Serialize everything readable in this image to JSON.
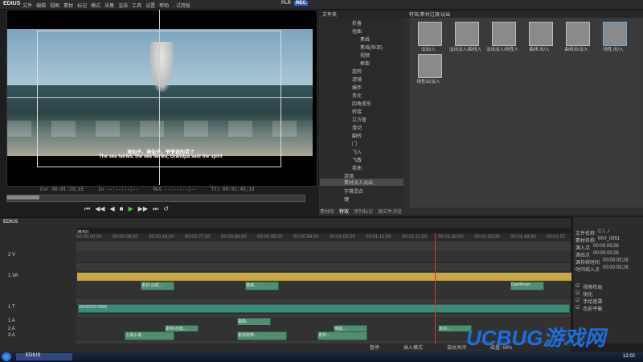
{
  "app": {
    "title": "EDIUS",
    "menus": [
      "文件",
      "编辑",
      "视图",
      "素材",
      "标记",
      "模式",
      "采集",
      "渲染",
      "工具",
      "设置",
      "帮助",
      "- 试用版"
    ],
    "plr": "PLR",
    "rec": "REC"
  },
  "preview": {
    "subtitle_cn": "海仙子，海仙子，爷爷说的灵了",
    "subtitle_en": "The sea fairies, the sea fairies, Grandpa said the spirit",
    "timecodes": [
      "Cur 00:01:29;15",
      "In --:--:--;--",
      "Out --:--:--;--",
      "Ttl 00:01:49;13"
    ]
  },
  "transport": [
    "⏮",
    "◀◀",
    "◀",
    "■",
    "▶",
    "▶▶",
    "⏭",
    "↺"
  ],
  "effects": {
    "header": "文件夹",
    "path": "特效/素材过渡/淡出",
    "tree": [
      "折叠",
      "扭曲",
      "素线",
      "素线(纵深)",
      "视频",
      "框架",
      "旋转",
      "滤镜",
      "爆炸",
      "变化",
      "四角变形",
      "转接",
      "立方管",
      "滑动",
      "翻转",
      "门",
      "飞入",
      "飞散",
      "卷曲",
      "涟漪",
      "素材淡入淡出",
      "字幕混合",
      "键"
    ],
    "selected": "素材淡入淡出",
    "items": [
      "淡出/入",
      "淡出淡入/曲线入",
      "淡出淡入/线性入",
      "曲线 出/入",
      "曲线出/淡入",
      "线性 出/入",
      "线性出/淡入"
    ],
    "tabs": [
      "素材库",
      "特效",
      "序列标记",
      "源文件浏览"
    ]
  },
  "timeline": {
    "title": "EDIUS",
    "seq": "序列1",
    "ruler": [
      "00:00:00;00",
      "00:00:09;00",
      "00:00:18;00",
      "00:00:27;00",
      "00:00:36;00",
      "00:00:45;00",
      "00:00:54;00",
      "00:01:03;00",
      "00:01:12;00",
      "00:01:21;00",
      "00:01:30;00",
      "00:01:39;00",
      "00:01:48;00",
      "00:01:57"
    ],
    "tracks": [
      "2 V",
      "1 VA",
      "1 T",
      "1 A",
      "2 A",
      "3 A",
      "4 A"
    ],
    "title_clip": "20150703-0000",
    "audio_clips": [
      "小溪小溪",
      "素材-合成...",
      "素材效果...",
      "歌曲...",
      "水中...",
      "歌曲...",
      "电视...",
      "素材...",
      "DSC...",
      "素材...",
      "DarkRoom",
      "海..."
    ]
  },
  "info": {
    "rows": [
      [
        "文件名称",
        "C:/.../"
      ],
      [
        "素材名称",
        "MVI_0851"
      ],
      [
        "源入点",
        "00:00:03;26"
      ],
      [
        "源出点",
        "00:00:03;28"
      ],
      [
        "源持续时间",
        "00:00:03;28"
      ],
      [
        "时间线入点",
        "00:00:03;26"
      ]
    ],
    "effects": [
      "视频布局",
      "锐化",
      "手绘遮罩",
      "色彩平衡"
    ]
  },
  "status": [
    "暂停",
    "插入模式",
    "波纹关闭",
    "磁盘: 68%"
  ],
  "taskbar": {
    "app": "EDIUS",
    "clock": "12:02",
    "watermark": "UCBUG游戏网"
  }
}
